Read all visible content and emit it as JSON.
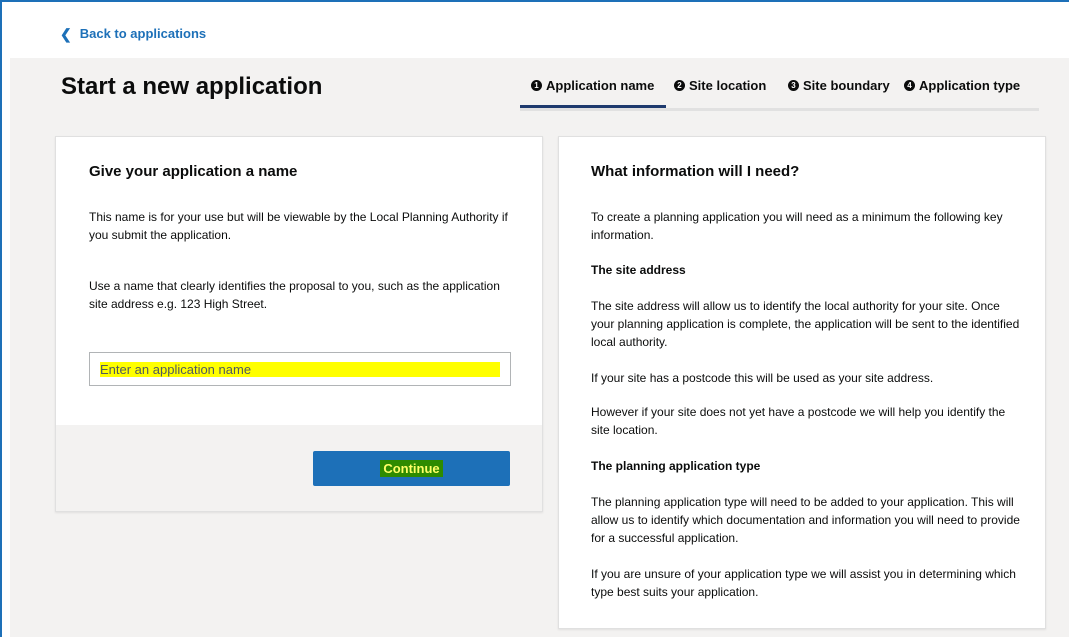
{
  "nav": {
    "back_label": "Back to applications"
  },
  "page": {
    "title": "Start a new application"
  },
  "steps": [
    {
      "number": "1",
      "label": "Application name",
      "active": true
    },
    {
      "number": "2",
      "label": "Site location",
      "active": false
    },
    {
      "number": "3",
      "label": "Site boundary",
      "active": false
    },
    {
      "number": "4",
      "label": "Application type",
      "active": false
    }
  ],
  "form": {
    "heading": "Give your application a name",
    "intro": "This name is for your use but will be viewable by the Local Planning Authority if you submit the application.",
    "hint": "Use a name that clearly identifies the proposal to you, such as the application site address e.g. 123 High Street.",
    "name_input": {
      "placeholder": "Enter an application name",
      "value": ""
    },
    "continue_label": "Continue"
  },
  "info": {
    "heading": "What information will I need?",
    "intro": "To create a planning application you will need as a minimum the following key information.",
    "site_address": {
      "heading": "The site address",
      "p1": "The site address will allow us to identify the local authority for your site. Once your planning application is complete, the application will be sent to the identified local authority.",
      "p2": "If your site has a postcode this will be used as your site address.",
      "p3": "However if your site does not yet have a postcode we will help you identify the site location."
    },
    "application_type": {
      "heading": "The planning application type",
      "p1": "The planning application type will need to be added to your application. This will allow us to identify which documentation and information you will need to provide for a successful application.",
      "p2": "If you are unsure of your application type we will assist you in determining which type best suits your application."
    }
  },
  "colors": {
    "link": "#1d70b8",
    "button": "#1d70b8",
    "active_step_underline": "#1e3a6e",
    "page_background": "#f3f2f1",
    "highlight": "#ffff00"
  }
}
